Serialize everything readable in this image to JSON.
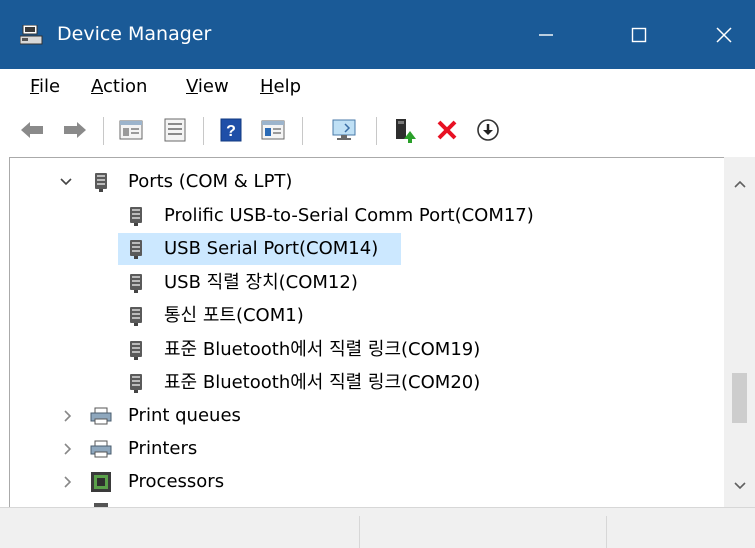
{
  "window": {
    "title": "Device Manager",
    "controls": [
      "minimize",
      "maximize",
      "close"
    ]
  },
  "menu": {
    "items": [
      "File",
      "Action",
      "View",
      "Help"
    ]
  },
  "toolbar": {
    "buttons": [
      "back-arrow-icon",
      "forward-arrow-icon",
      "properties-icon",
      "list-icon",
      "help-icon",
      "show-hidden-icon",
      "monitor-scan-icon",
      "update-driver-icon",
      "uninstall-icon",
      "download-icon"
    ]
  },
  "tree": {
    "ports": {
      "label": "Ports (COM & LPT)",
      "expanded": true,
      "children": [
        {
          "label": "Prolific USB-to-Serial Comm Port(COM17)",
          "selected": false
        },
        {
          "label": "USB Serial Port(COM14)",
          "selected": true
        },
        {
          "label": "USB 직렬 장치(COM12)",
          "selected": false
        },
        {
          "label": "통신 포트(COM1)",
          "selected": false
        },
        {
          "label": "표준 Bluetooth에서 직렬 링크(COM19)",
          "selected": false
        },
        {
          "label": "표준 Bluetooth에서 직렬 링크(COM20)",
          "selected": false
        }
      ]
    },
    "categories": [
      {
        "label": "Print queues",
        "expanded": false
      },
      {
        "label": "Printers",
        "expanded": false
      },
      {
        "label": "Processors",
        "expanded": false
      }
    ]
  },
  "colors": {
    "titlebar": "#1a5a97",
    "selection": "#cce8ff",
    "uninstall_red": "#e81123",
    "update_green": "#2aa02a"
  }
}
